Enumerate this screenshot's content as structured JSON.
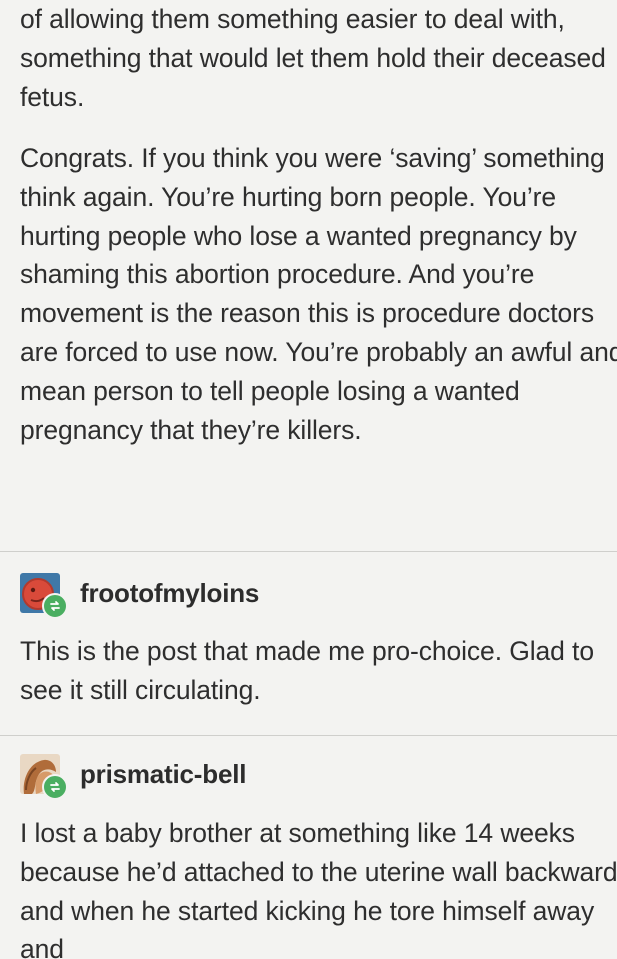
{
  "post": {
    "paragraph_1": "of allowing them something easier to deal with, something that would let them hold their deceased fetus.",
    "paragraph_2": "Congrats. If you think you were ‘saving’ something think again. You’re hurting born people. You’re hurting people who lose a wanted pregnancy by shaming this abortion procedure. And you’re movement is the reason this is procedure doctors are forced to use now. You’re probably an awful and mean person to tell people losing a wanted pregnancy that they’re killers."
  },
  "reblogs": [
    {
      "username": "frootofmyloins",
      "avatar_icon": "red-circle-avatar-icon",
      "badge_icon": "reblog-icon",
      "text": "This is the post that made me pro-choice. Glad to see it still circulating."
    },
    {
      "username": "prismatic-bell",
      "avatar_icon": "illustration-avatar-icon",
      "badge_icon": "reblog-icon",
      "text": "I lost a baby brother at something like 14 weeks because he’d attached to the uterine wall backward, and when he started kicking he tore himself away and"
    }
  ],
  "colors": {
    "background": "#f3f3f1",
    "text": "#2e2e2e",
    "divider": "#cfcfcc",
    "reblog_badge": "#4aae61"
  }
}
